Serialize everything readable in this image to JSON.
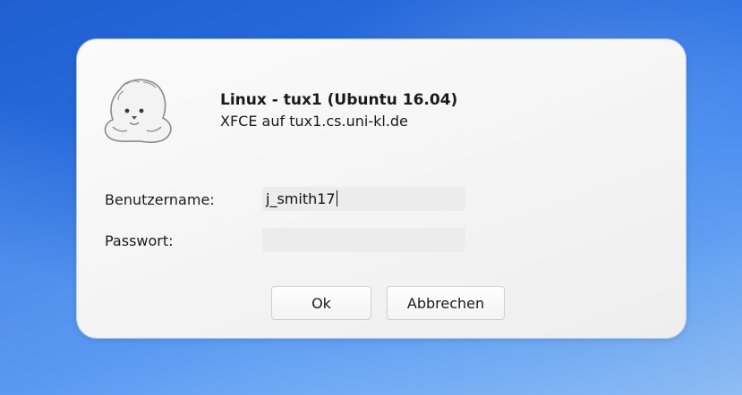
{
  "dialog": {
    "title": "Linux - tux1 (Ubuntu 16.04)",
    "subtitle": "XFCE auf tux1.cs.uni-kl.de",
    "logo_icon": "seal-mascot-icon"
  },
  "form": {
    "username_label": "Benutzername:",
    "username_value": "j_smith17",
    "password_label": "Passwort:",
    "password_value": ""
  },
  "buttons": {
    "ok_label": "Ok",
    "cancel_label": "Abbrechen"
  },
  "colors": {
    "background_blue": "#2a6ee0",
    "dialog_bg": "#f6f6f6",
    "field_bg": "#ececec"
  }
}
